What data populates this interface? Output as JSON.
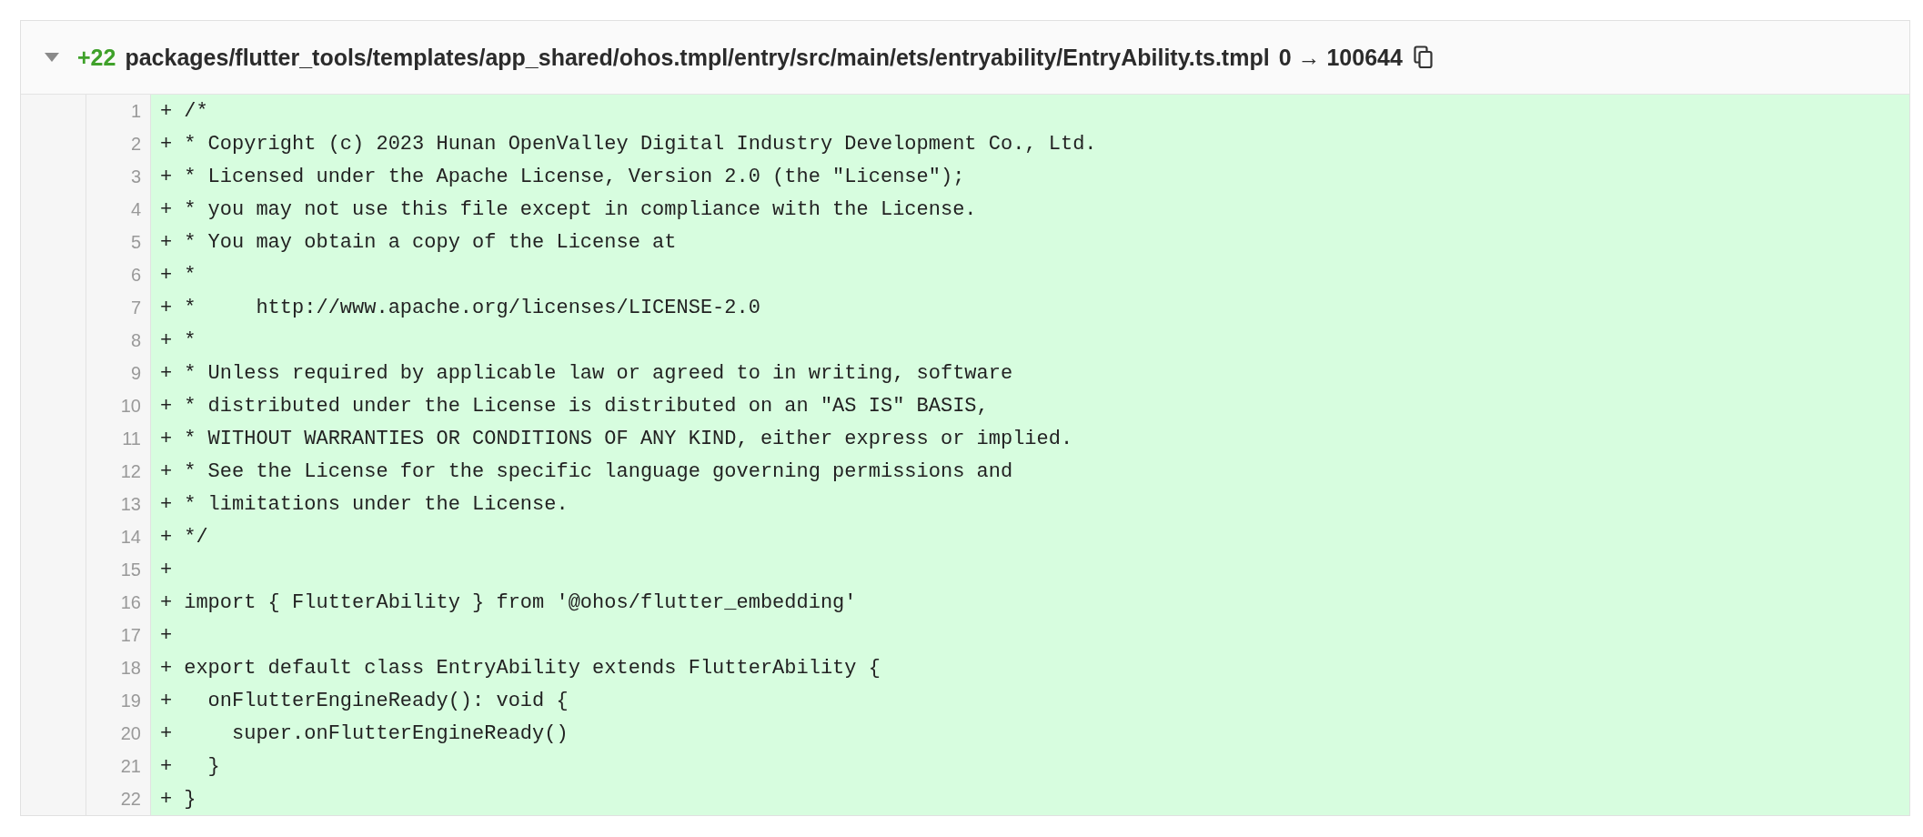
{
  "file_header": {
    "expanded": true,
    "additions": "+22",
    "path": "packages/flutter_tools/templates/app_shared/ohos.tmpl/entry/src/main/ets/entryability/EntryAbility.ts.tmpl",
    "mode_change": "0 → 100644"
  },
  "lines": [
    {
      "number": "1",
      "marker": "+",
      "code": "/*"
    },
    {
      "number": "2",
      "marker": "+",
      "code": "* Copyright (c) 2023 Hunan OpenValley Digital Industry Development Co., Ltd."
    },
    {
      "number": "3",
      "marker": "+",
      "code": "* Licensed under the Apache License, Version 2.0 (the \"License\");"
    },
    {
      "number": "4",
      "marker": "+",
      "code": "* you may not use this file except in compliance with the License."
    },
    {
      "number": "5",
      "marker": "+",
      "code": "* You may obtain a copy of the License at"
    },
    {
      "number": "6",
      "marker": "+",
      "code": "*"
    },
    {
      "number": "7",
      "marker": "+",
      "code": "*     http://www.apache.org/licenses/LICENSE-2.0"
    },
    {
      "number": "8",
      "marker": "+",
      "code": "*"
    },
    {
      "number": "9",
      "marker": "+",
      "code": "* Unless required by applicable law or agreed to in writing, software"
    },
    {
      "number": "10",
      "marker": "+",
      "code": "* distributed under the License is distributed on an \"AS IS\" BASIS,"
    },
    {
      "number": "11",
      "marker": "+",
      "code": "* WITHOUT WARRANTIES OR CONDITIONS OF ANY KIND, either express or implied."
    },
    {
      "number": "12",
      "marker": "+",
      "code": "* See the License for the specific language governing permissions and"
    },
    {
      "number": "13",
      "marker": "+",
      "code": "* limitations under the License."
    },
    {
      "number": "14",
      "marker": "+",
      "code": "*/"
    },
    {
      "number": "15",
      "marker": "+"
    },
    {
      "number": "16",
      "marker": "+",
      "code": "import { FlutterAbility } from '@ohos/flutter_embedding'"
    },
    {
      "number": "17",
      "marker": "+"
    },
    {
      "number": "18",
      "marker": "+",
      "code": "export default class EntryAbility extends FlutterAbility {"
    },
    {
      "number": "19",
      "marker": "+",
      "code": "  onFlutterEngineReady(): void {"
    },
    {
      "number": "20",
      "marker": "+",
      "code": "    super.onFlutterEngineReady()"
    },
    {
      "number": "21",
      "marker": "+",
      "code": "  }"
    },
    {
      "number": "22",
      "marker": "+",
      "code": "}"
    }
  ]
}
